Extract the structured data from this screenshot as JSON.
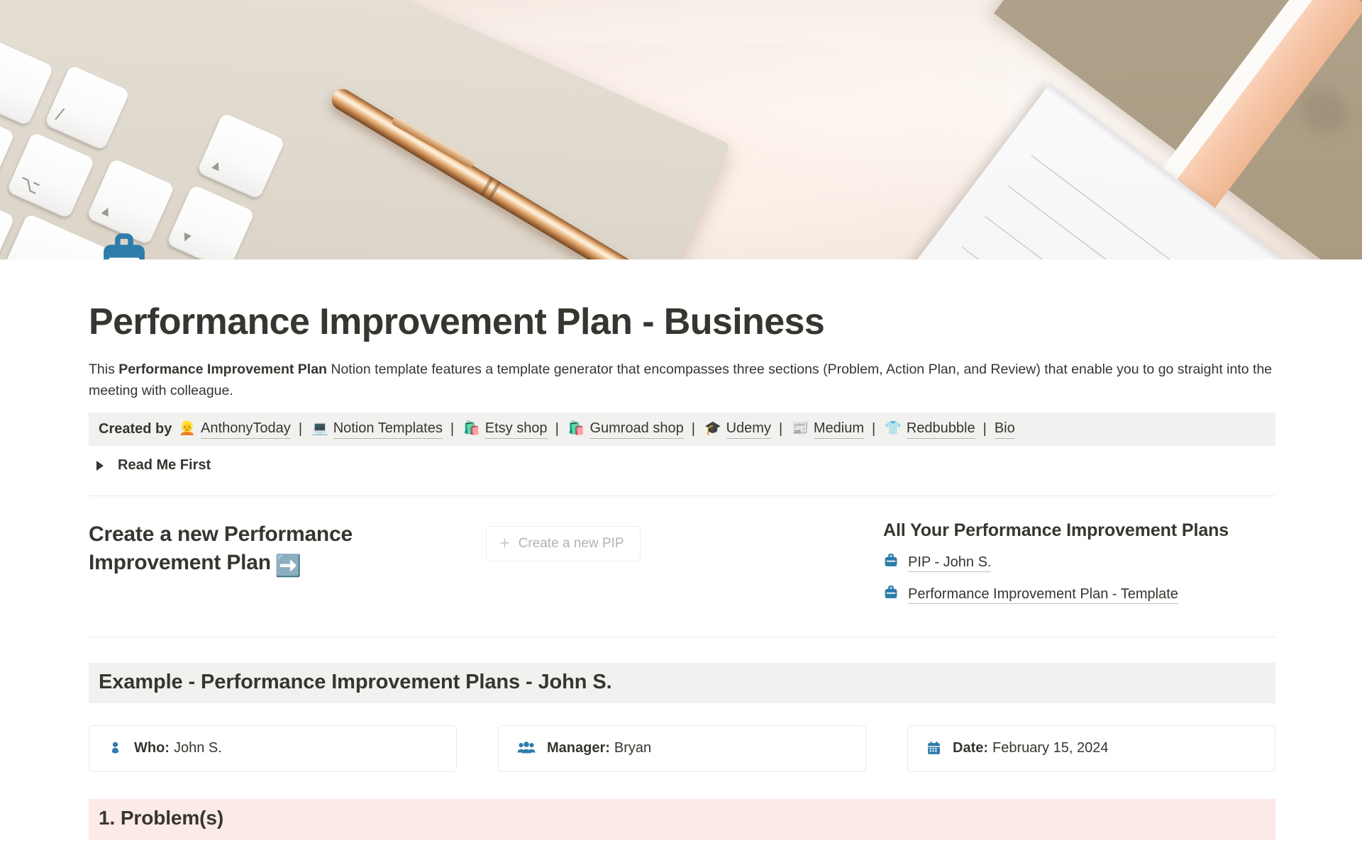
{
  "cover": {
    "alt": "Apple keyboard with rose gold pen and notepad on cream background"
  },
  "page": {
    "icon": "briefcase-icon",
    "title": "Performance Improvement Plan - Business",
    "description_pre": "This ",
    "description_bold": "Performance Improvement Plan",
    "description_post": " Notion template features a template generator that encompasses three sections (Problem, Action Plan, and Review) that enable you to go straight into the meeting with colleague."
  },
  "created_by": {
    "label": "Created by",
    "links": [
      {
        "emoji": "👱",
        "label": "AnthonyToday",
        "icon": "person-blond-emoji"
      },
      {
        "emoji": "💻",
        "label": "Notion Templates",
        "icon": "laptop-emoji"
      },
      {
        "emoji": "🛍️",
        "label": "Etsy shop",
        "icon": "shopping-bags-emoji"
      },
      {
        "emoji": "🛍️",
        "label": "Gumroad shop",
        "icon": "shopping-bags-emoji"
      },
      {
        "emoji": "🎓",
        "label": "Udemy",
        "icon": "graduation-cap-emoji"
      },
      {
        "emoji": "📰",
        "label": "Medium",
        "icon": "newspaper-emoji"
      },
      {
        "emoji": "👕",
        "label": "Redbubble",
        "icon": "tshirt-emoji"
      },
      {
        "emoji": "",
        "label": "Bio",
        "icon": "none"
      }
    ],
    "separator": "|"
  },
  "toggle": {
    "label": "Read Me First",
    "state": "collapsed"
  },
  "create_section": {
    "heading": "Create a new Performance Improvement Plan",
    "heading_emoji": "➡️",
    "button_label": "Create a new PIP",
    "button_plus": "+"
  },
  "all_plans": {
    "heading": "All Your Performance Improvement Plans",
    "items": [
      {
        "icon": "briefcase-icon",
        "label": "PIP - John S."
      },
      {
        "icon": "briefcase-icon",
        "label": "Performance Improvement Plan - Template"
      }
    ]
  },
  "example": {
    "heading": "Example - Performance Improvement Plans - John S.",
    "cards": [
      {
        "icon": "person-icon",
        "label": "Who:",
        "value": "John S."
      },
      {
        "icon": "people-icon",
        "label": "Manager:",
        "value": "Bryan"
      },
      {
        "icon": "calendar-icon",
        "label": "Date:",
        "value": "February 15, 2024"
      }
    ]
  },
  "problem_section": {
    "heading": "1. Problem(s)"
  },
  "colors": {
    "icon_blue": "#2e7cab",
    "callout_gray": "#f1f1ef",
    "problem_pink": "#fbeae8",
    "text": "#37352f"
  }
}
